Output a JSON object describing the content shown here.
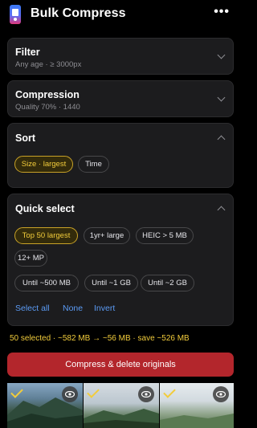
{
  "header": {
    "title": "Bulk Compress",
    "more_icon": "more-horizontal-icon"
  },
  "filter": {
    "title": "Filter",
    "summary": "Any age · ≥ 3000px"
  },
  "compression": {
    "title": "Compression",
    "summary": "Quality 70% · 1440"
  },
  "sort": {
    "title": "Sort",
    "options": [
      {
        "label": "Size · largest",
        "selected": true
      },
      {
        "label": "Time",
        "selected": false
      }
    ]
  },
  "quick_select": {
    "title": "Quick select",
    "chips": [
      {
        "label": "Top 50 largest",
        "selected": true
      },
      {
        "label": "1yr+ large",
        "selected": false
      },
      {
        "label": "HEIC > 5 MB",
        "selected": false
      },
      {
        "label": "12+ MP",
        "selected": false
      },
      {
        "label": "Until ~500 MB",
        "selected": false
      },
      {
        "label": "Until ~1 GB",
        "selected": false
      },
      {
        "label": "Until ~2 GB",
        "selected": false
      }
    ],
    "links": {
      "select_all": "Select all",
      "none": "None",
      "invert": "Invert"
    }
  },
  "summary": "50 selected · ~582 MB → ~56 MB · save ~526 MB",
  "primary_button": "Compress & delete originals",
  "colors": {
    "accent": "#f2cc3b",
    "danger": "#b3262c",
    "link": "#5b9bf5",
    "card": "#1c1c1e"
  },
  "thumbnails": [
    {
      "selected": true,
      "icon": "eye-icon"
    },
    {
      "selected": true,
      "icon": "eye-icon"
    },
    {
      "selected": true,
      "icon": "eye-icon"
    }
  ]
}
